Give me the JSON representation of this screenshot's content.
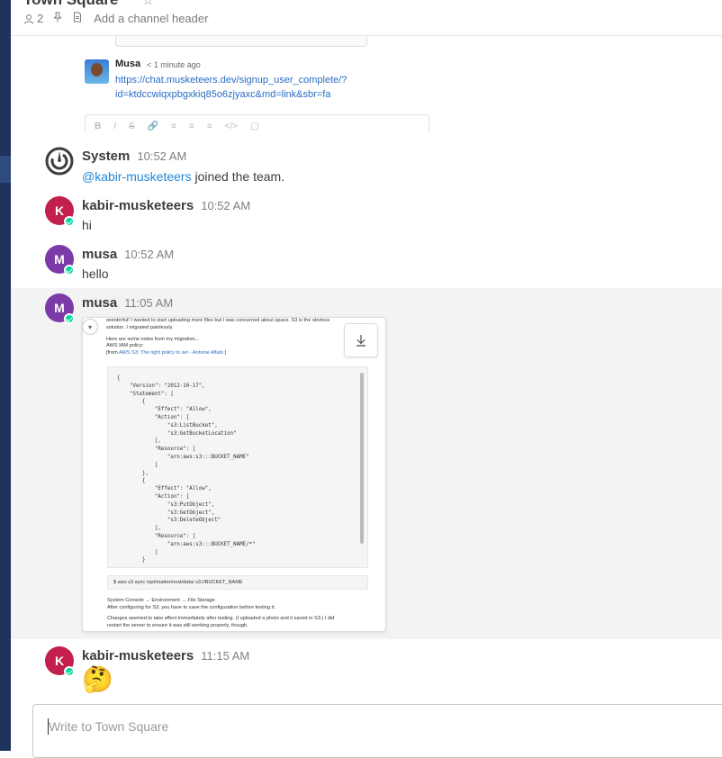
{
  "channel": {
    "title": "Town Square",
    "member_count": "2",
    "header_placeholder": "Add a channel header"
  },
  "preview": {
    "author": "Musa",
    "time": "1 minute ago",
    "link_line1": "https://chat.musketeers.dev/signup_user_complete/?",
    "link_line2": "id=ktdccwiqxpbgxkiq85o6zjyaxc&md=link&sbr=fa"
  },
  "posts": [
    {
      "author": "System",
      "time": "10:52 AM",
      "mention": "@kabir-musketeers",
      "text": " joined the team."
    },
    {
      "author": "kabir-musketeers",
      "initial": "K",
      "time": "10:52 AM",
      "text": "hi"
    },
    {
      "author": "musa",
      "initial": "M",
      "time": "10:52 AM",
      "text": "hello"
    },
    {
      "author": "musa",
      "initial": "M",
      "time": "11:05 AM"
    },
    {
      "author": "kabir-musketeers",
      "initial": "K",
      "time": "11:15 AM",
      "emoji": "🤔"
    }
  ],
  "attachment": {
    "line1": "wonderful! I wanted to start uploading more files but I was concerned about space. S3 is the obvious",
    "line2": "solution. I migrated painlessly.",
    "line3": "Here are some notes from my migration...",
    "line4": "AWS IAM policy:",
    "line5_prefix": "[from ",
    "line5_link": "AWS S3: The right policy to set - Antoine Aflalo",
    "line5_suffix": " ]",
    "code": "{\n    \"Version\": \"2012-10-17\",\n    \"Statement\": [\n        {\n            \"Effect\": \"Allow\",\n            \"Action\": [\n                \"s3:ListBucket\",\n                \"s3:GetBucketLocation\"\n            ],\n            \"Resource\": [\n                \"arn:aws:s3:::BUCKET_NAME\"\n            ]\n        },\n        {\n            \"Effect\": \"Allow\",\n            \"Action\": [\n                \"s3:PutObject\",\n                \"s3:GetObject\",\n                \"s3:DeleteObject\"\n            ],\n            \"Resource\": [\n                \"arn:aws:s3:::BUCKET_NAME/*\"\n            ]\n        }",
    "command": "$ aws s3 sync /opt/mattermost/data/ s3://BUCKET_NAME",
    "after1": "System Console → Environment → File Storage",
    "after2": "After configuring for S3, you have to save the configuration before testing it.",
    "after3": "Changes seemed to take effect immediately after testing. (I uploaded a photo and it saved in S3.) I did",
    "after4": "restart the server to ensure it was still working properly, though."
  },
  "input": {
    "placeholder": "Write to Town Square"
  },
  "colors": {
    "sidebar": "#1e325c",
    "avatar_k": "#c21f4c",
    "avatar_m": "#7b3aa8",
    "online": "#06d6a0",
    "mention": "#2389d7"
  }
}
